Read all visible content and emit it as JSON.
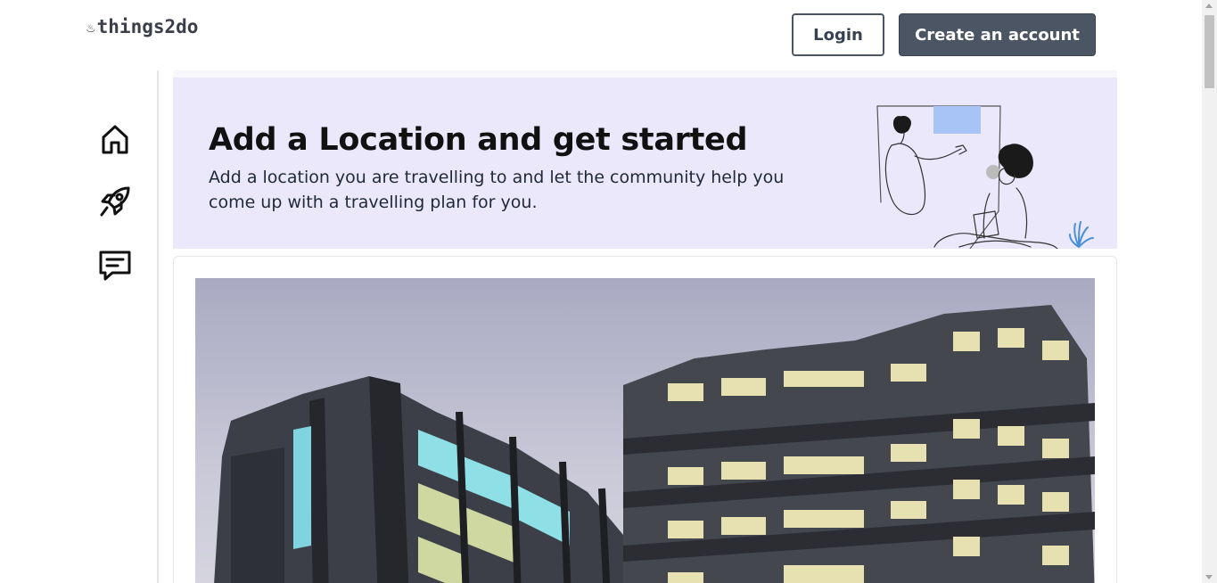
{
  "header": {
    "logo_text": "things2do",
    "logo_icon": "flame-icon",
    "login_label": "Login",
    "create_account_label": "Create an account"
  },
  "sidebar": {
    "items": [
      {
        "icon": "home-icon"
      },
      {
        "icon": "rocket-icon"
      },
      {
        "icon": "message-icon"
      }
    ]
  },
  "banner": {
    "title": "Add a Location and get started",
    "description": "Add a location you are travelling to and let the community help you come up with a travelling plan for you."
  },
  "colors": {
    "banner_bg": "#ebe8fc",
    "primary_button": "#4b5563",
    "accent_blue": "#a8c4f7"
  }
}
